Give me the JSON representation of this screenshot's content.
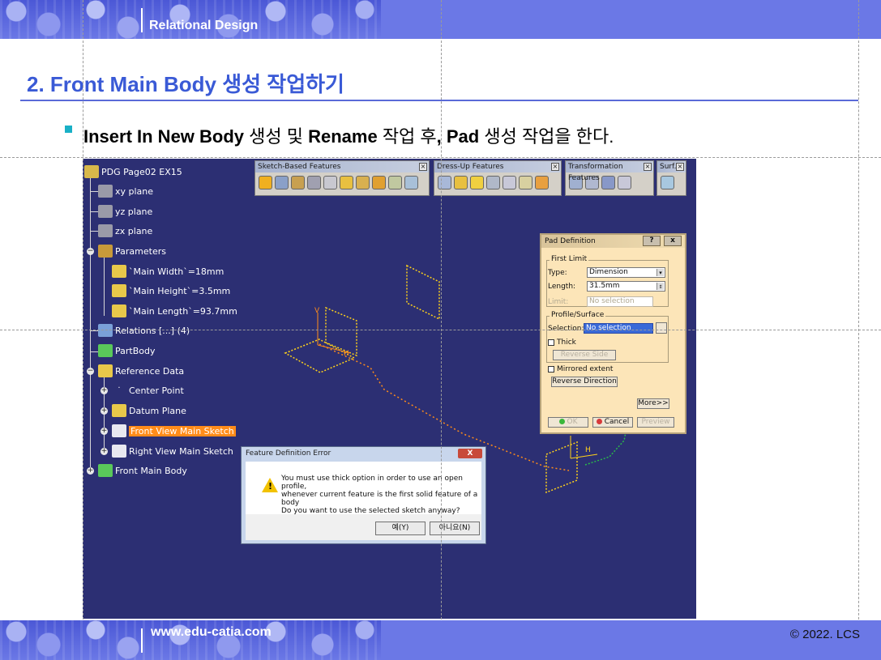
{
  "header": {
    "section_title": "Relational Design"
  },
  "slide": {
    "title": "2. Front Main Body 생성 작업하기",
    "bullet": {
      "part1": "Insert In New Body",
      "part2": " 생성 및 ",
      "part3": "Rename",
      "part4": " 작업 후",
      "part5": ", Pad",
      "part6": " 생성 작업을 한다."
    }
  },
  "footer": {
    "website": "www.edu-catia.com",
    "copyright": "© 2022. LCS"
  },
  "catia": {
    "tree": {
      "root": "PDG Page02 EX15",
      "items": [
        "xy plane",
        "yz plane",
        "zx plane",
        "Parameters",
        "`Main Width`=18mm",
        "`Main Height`=3.5mm",
        "`Main Length`=93.7mm",
        "Relations [...] (4)",
        "PartBody",
        "Reference Data",
        "Center Point",
        "Datum Plane",
        "Front View Main Sketch",
        "Right View Main Sketch",
        "Front Main Body"
      ]
    },
    "toolbars": [
      {
        "title": "Sketch-Based Features"
      },
      {
        "title": "Dress-Up Features"
      },
      {
        "title": "Transformation Features"
      },
      {
        "title": "Surf..."
      }
    ],
    "pad_dialog": {
      "title": "Pad Definition",
      "help_btn": "?",
      "close_btn": "x",
      "first_limit_label": "First Limit",
      "type_label": "Type:",
      "type_value": "Dimension",
      "length_label": "Length:",
      "length_value": "31.5mm",
      "limit_label": "Limit:",
      "limit_value": "No selection",
      "profile_label": "Profile/Surface",
      "selection_label": "Selection:",
      "selection_value": "No selection",
      "thick_label": "Thick",
      "reverse_side": "Reverse Side",
      "mirrored_label": "Mirrored extent",
      "reverse_direction": "Reverse Direction",
      "more": "More>>",
      "ok": "OK",
      "cancel": "Cancel",
      "preview": "Preview"
    },
    "error_dialog": {
      "title": "Feature Definition Error",
      "close": "X",
      "line1": "You must use thick option in order to use an open profile,",
      "line2": "whenever current feature is the first solid feature of a body",
      "line3": "Do you want to use the selected sketch anyway?",
      "yes": "예(Y)",
      "no": "아니요(N)"
    },
    "axis": {
      "v": "V",
      "h": "H"
    }
  },
  "colors": {
    "band": "#6b78e6",
    "title": "#3a5ad6",
    "canvas": "#2c2f73",
    "selected": "#ff8c1a",
    "sketch": "#ffd21a"
  }
}
